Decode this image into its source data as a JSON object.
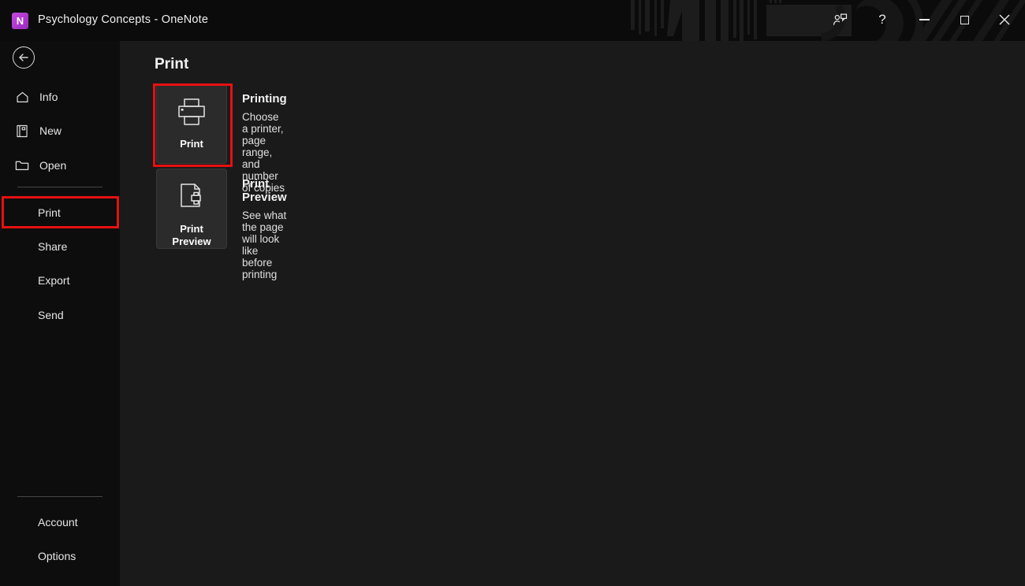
{
  "titlebar": {
    "logo_letter": "N",
    "title": "Psychology Concepts  -  OneNote",
    "buttons": [
      {
        "name": "share",
        "label": "Share"
      },
      {
        "name": "help",
        "label": "?"
      },
      {
        "name": "minimize",
        "label": "Minimize"
      },
      {
        "name": "maximize",
        "label": "Maximize"
      },
      {
        "name": "close",
        "label": "Close"
      }
    ]
  },
  "sidebar": {
    "back_label": "Back",
    "items": [
      {
        "label": "Info",
        "icon": "home-icon",
        "selected": false
      },
      {
        "label": "New",
        "icon": "notebook-icon",
        "selected": false
      },
      {
        "label": "Open",
        "icon": "folder-icon",
        "selected": false
      },
      {
        "label": "Print",
        "icon": "",
        "selected": true
      },
      {
        "label": "Share",
        "icon": "",
        "selected": false
      },
      {
        "label": "Export",
        "icon": "",
        "selected": false
      },
      {
        "label": "Send",
        "icon": "",
        "selected": false
      },
      {
        "label": "Account",
        "icon": "",
        "selected": false
      },
      {
        "label": "Options",
        "icon": "",
        "selected": false
      }
    ]
  },
  "main": {
    "page_title": "Print",
    "options": [
      {
        "tile_label": "Print",
        "icon": "printer-icon",
        "title": "Printing",
        "description": "Choose a printer, page range, and number of copies"
      },
      {
        "tile_label": "Print\nPreview",
        "icon": "print-preview-icon",
        "title": "Print Preview",
        "description": "See what the page will look like before printing"
      }
    ]
  },
  "annotations": {
    "color": "#e81010",
    "targets": [
      "sidebar-item-print",
      "print-tile"
    ]
  },
  "colors": {
    "accent_purple": "#9b29bd",
    "sidebar_bg": "#0d0d0d",
    "content_bg": "#1a1a1a",
    "tile_bg": "#2b2b2b",
    "annotation_red": "#e81010"
  }
}
